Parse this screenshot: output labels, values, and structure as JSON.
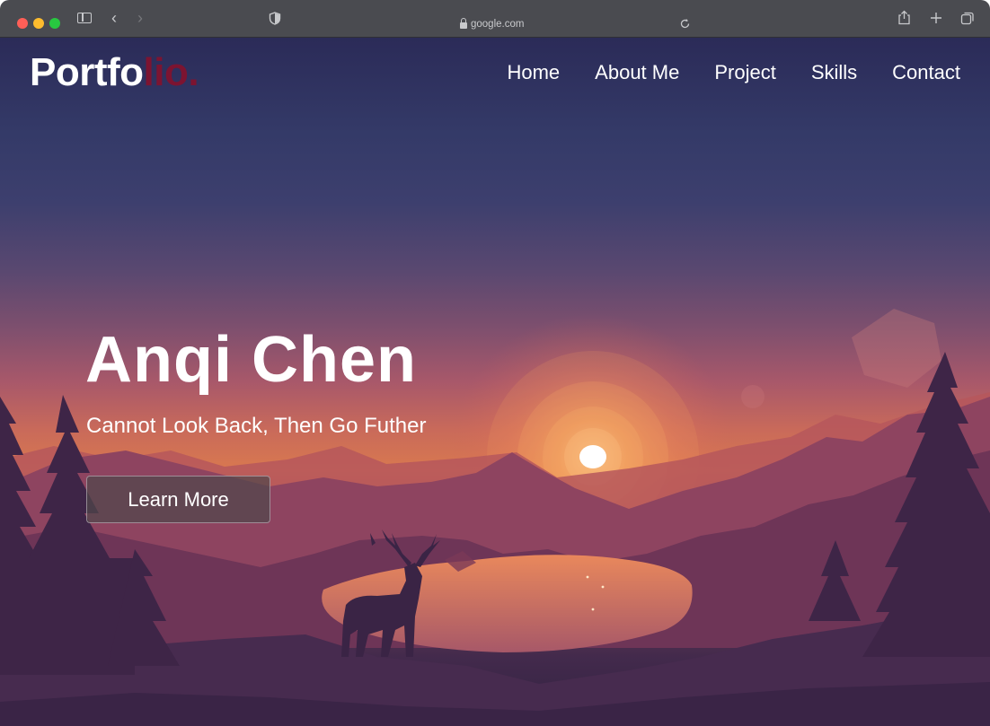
{
  "browser": {
    "url": "google.com",
    "icons": [
      "sidebar-icon",
      "back-icon",
      "forward-icon",
      "shield-icon",
      "lock-icon",
      "reload-icon",
      "share-icon",
      "new-tab-icon",
      "tabs-overview-icon"
    ]
  },
  "site": {
    "logo_main": "Portfo",
    "logo_accent": "lio.",
    "logo_accent_color": "#7c1431",
    "nav": [
      "Home",
      "About Me",
      "Project",
      "Skills",
      "Contact"
    ]
  },
  "hero": {
    "name": "Anqi Chen",
    "tagline": "Cannot Look Back, Then Go Futher",
    "button_label": "Learn More"
  }
}
